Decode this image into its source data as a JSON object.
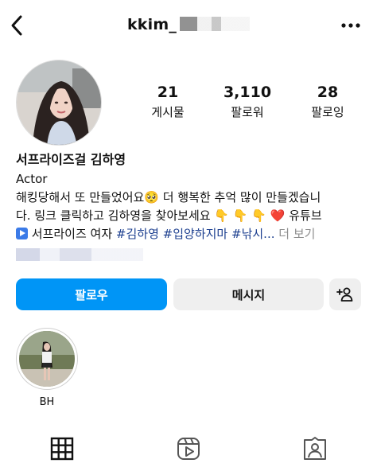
{
  "header": {
    "username": "kkim_",
    "back_icon": "chevron-left-icon",
    "more_icon": "more-horizontal-icon"
  },
  "stats": {
    "posts": {
      "count": "21",
      "label": "게시물"
    },
    "followers": {
      "count": "3,110",
      "label": "팔로워"
    },
    "following": {
      "count": "28",
      "label": "팔로잉"
    }
  },
  "bio": {
    "name": "서프라이즈걸 김하영",
    "category": "Actor",
    "line1_text": "해킹당해서 또 만들었어요",
    "line1_emoji": "🥺",
    "line1_rest": " 더 행복한 추억 많이 만들겠습니",
    "line2_text": "다.  링크 클릭하고 김하영을 찾아보세요 ",
    "line2_emojis": "👇 👇 👇 ",
    "line2_heart": "❤️",
    "line2_rest": " 유튜브",
    "line3_text": " 서프라이즈 여자 ",
    "hashtags": [
      "#김하영",
      "#입양하지마",
      "#낚시..."
    ],
    "more": "더 보기"
  },
  "buttons": {
    "follow": "팔로우",
    "message": "메시지",
    "add_user_icon": "add-person-icon"
  },
  "highlights": [
    {
      "label": "BH"
    }
  ],
  "tabs": [
    {
      "icon": "grid-icon"
    },
    {
      "icon": "reels-icon"
    },
    {
      "icon": "tagged-icon"
    }
  ],
  "colors": {
    "primary_button": "#0095f6",
    "secondary_button": "#efefef",
    "hashtag": "#1c3f8f",
    "muted": "#8e8e8e"
  }
}
